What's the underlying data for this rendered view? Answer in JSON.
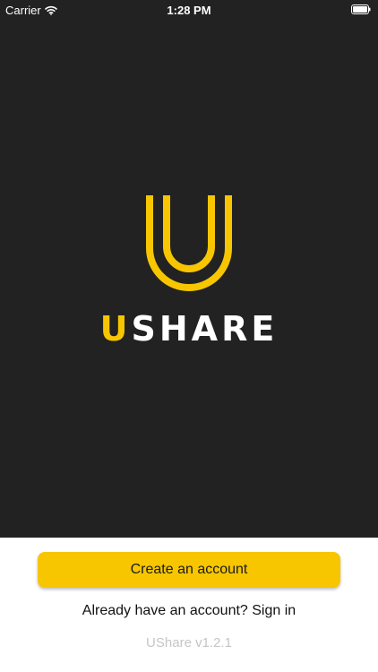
{
  "status_bar": {
    "carrier": "Carrier",
    "time": "1:28 PM",
    "wifi_icon": "wifi-icon",
    "battery_icon": "battery-icon"
  },
  "logo": {
    "mark_icon": "ushare-u-logo-icon",
    "word_accent": "U",
    "word_rest": "SHARE"
  },
  "actions": {
    "create_account_label": "Create an account",
    "sign_in_label": "Already have an account? Sign in"
  },
  "footer": {
    "version": "UShare v1.2.1"
  },
  "colors": {
    "accent": "#f7c600",
    "background_dark": "#222222",
    "background_light": "#ffffff",
    "text_muted": "#c6c6c6"
  }
}
